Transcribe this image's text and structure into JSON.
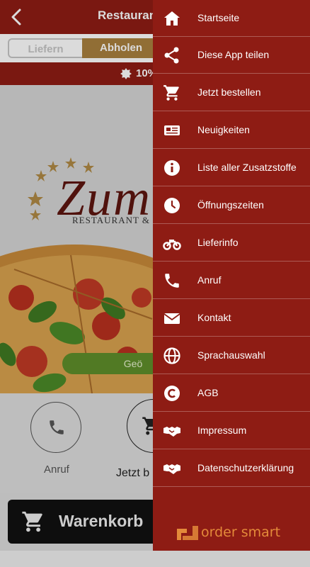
{
  "header": {
    "title": "Restaurant"
  },
  "tabs": [
    {
      "label": "Liefern"
    },
    {
      "label": "Abholen"
    }
  ],
  "promo": {
    "text": "10%"
  },
  "hero": {
    "logo_text": "Zum",
    "logo_sub": "RESTAURANT & P",
    "button_label": "Geö"
  },
  "actions": [
    {
      "label": "Anruf"
    },
    {
      "label": "Jetzt b"
    }
  ],
  "cart": {
    "label": "Warenkorb"
  },
  "menu": {
    "items": [
      {
        "label": "Startseite",
        "icon": "home-icon"
      },
      {
        "label": "Diese App teilen",
        "icon": "share-icon"
      },
      {
        "label": "Jetzt bestellen",
        "icon": "cart-icon"
      },
      {
        "label": "Neuigkeiten",
        "icon": "newspaper-icon"
      },
      {
        "label": "Liste aller Zusatzstoffe",
        "icon": "info-icon"
      },
      {
        "label": "Öffnungszeiten",
        "icon": "clock-icon"
      },
      {
        "label": "Lieferinfo",
        "icon": "motorcycle-icon"
      },
      {
        "label": "Anruf",
        "icon": "phone-icon"
      },
      {
        "label": "Kontakt",
        "icon": "envelope-icon"
      },
      {
        "label": "Sprachauswahl",
        "icon": "globe-icon"
      },
      {
        "label": "AGB",
        "icon": "copyright-icon"
      },
      {
        "label": "Impressum",
        "icon": "handshake-icon"
      },
      {
        "label": "Datenschutzerklärung",
        "icon": "handshake-icon"
      }
    ],
    "brand": "order smart"
  },
  "colors": {
    "primary": "#8e1c14",
    "accent": "#a9803e",
    "brand": "#e38a3a"
  }
}
